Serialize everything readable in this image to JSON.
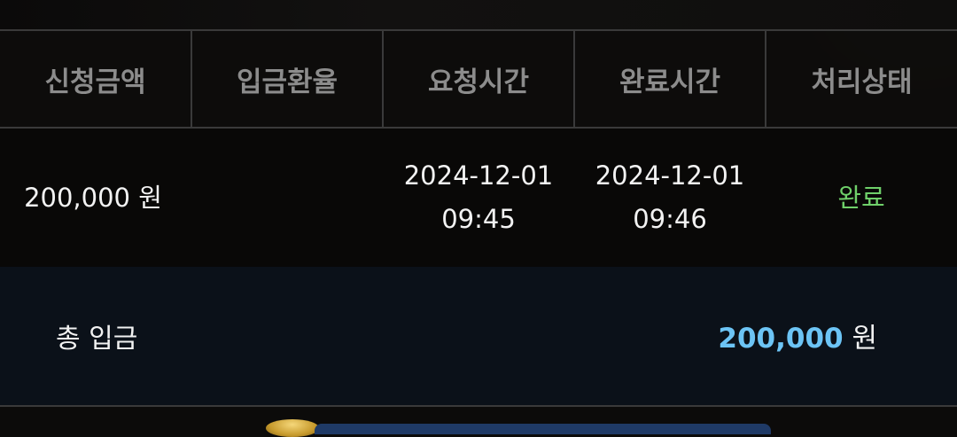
{
  "table": {
    "headers": [
      "신청금액",
      "입금환율",
      "요청시간",
      "완료시간",
      "처리상태"
    ],
    "rows": [
      {
        "amount": "200,000 원",
        "rate": "",
        "request_date": "2024-12-01",
        "request_time": "09:45",
        "complete_date": "2024-12-01",
        "complete_time": "09:46",
        "status": "완료"
      }
    ]
  },
  "summary": {
    "label": "총 입금",
    "total_value": "200,000",
    "total_unit": "원"
  },
  "colors": {
    "status_done": "#6fd06a",
    "total_highlight": "#6cc4f5",
    "header_text": "#8c8c8c"
  }
}
